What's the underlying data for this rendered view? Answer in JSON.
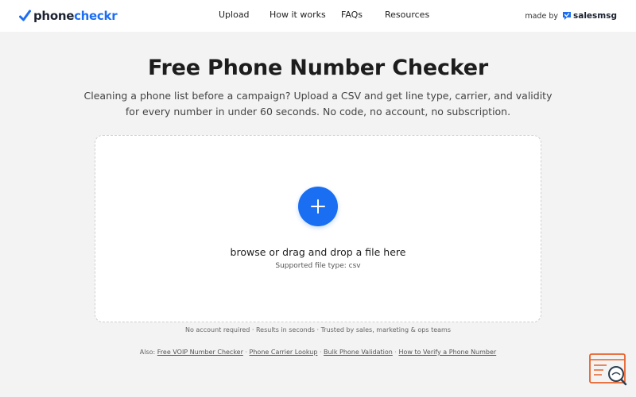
{
  "header": {
    "logo_part1": "phone",
    "logo_part2": "checkr",
    "nav": [
      "Upload",
      "How it works",
      "FAQs",
      "Resources"
    ],
    "made_by": "made by",
    "made_by_brand": "salesmsg"
  },
  "hero": {
    "title": "Free Phone Number Checker",
    "subtitle": "Cleaning a phone list before a campaign? Upload a CSV and get line type, carrier, and validity for every number in under 60 seconds. No code, no account, no subscription."
  },
  "dropzone": {
    "main_text": "browse or drag and drop a file here",
    "supported": "Supported file type: csv",
    "icon": "plus-icon"
  },
  "footer": {
    "trust": "No account required · Results in seconds · Trusted by sales, marketing & ops teams",
    "also_label": "Also:",
    "links": [
      "Free VOIP Number Checker",
      "Phone Carrier Lookup",
      "Bulk Phone Validation",
      "How to Verify a Phone Number"
    ],
    "separator": " · "
  },
  "colors": {
    "accent": "#1a6ef2",
    "background": "#f3f3f3",
    "widget": "#e8622a"
  }
}
